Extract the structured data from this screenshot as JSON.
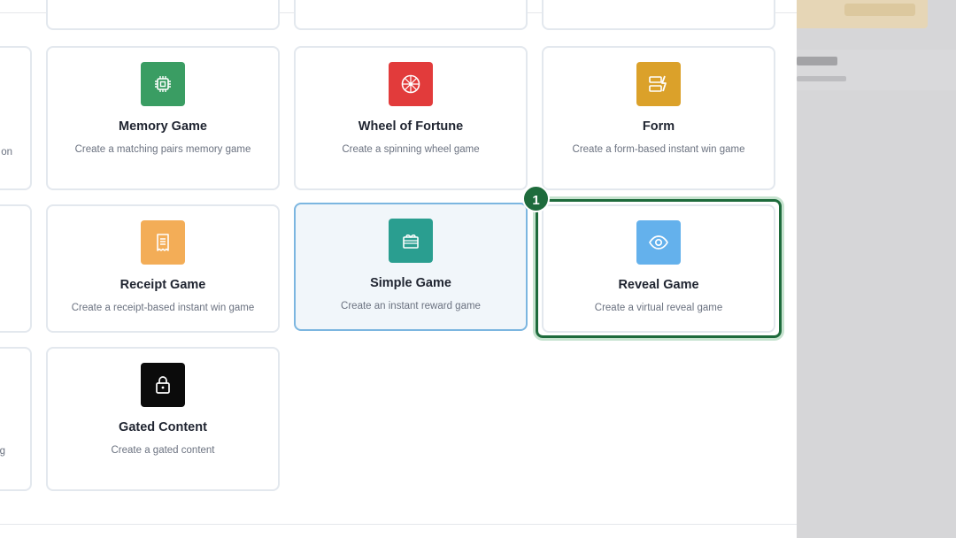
{
  "cards": [
    {
      "title": "Memory Game",
      "description": "Create a matching pairs memory game",
      "icon": "memory-chip-icon",
      "color": "#3a9d63"
    },
    {
      "title": "Wheel of Fortune",
      "description": "Create a spinning wheel game",
      "icon": "wheel-icon",
      "color": "#e23b3b"
    },
    {
      "title": "Form",
      "description": "Create a form-based instant win game",
      "icon": "form-icon",
      "color": "#dba12a"
    },
    {
      "title": "Receipt Game",
      "description": "Create a receipt-based instant win game",
      "icon": "receipt-icon",
      "color": "#f3ad57"
    },
    {
      "title": "Simple Game",
      "description": "Create an instant reward game",
      "icon": "gift-icon",
      "color": "#2a9e90"
    },
    {
      "title": "Reveal Game",
      "description": "Create a virtual reveal game",
      "icon": "eye-icon",
      "color": "#64b1ec"
    },
    {
      "title": "Gated Content",
      "description": "Create a gated content",
      "icon": "lock-icon",
      "color": "#0b0b0b"
    }
  ],
  "partial": {
    "row1_desc_tail": "on",
    "row3_desc_tail": "g"
  },
  "highlight": {
    "step_number": "1",
    "color": "#1e6b3c"
  }
}
